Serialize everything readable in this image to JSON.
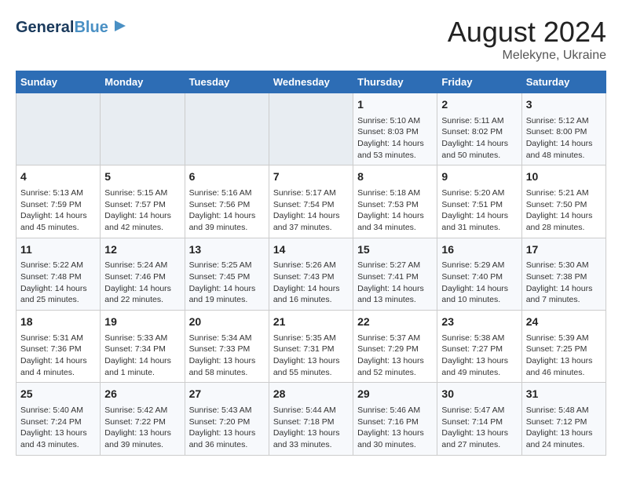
{
  "header": {
    "logo_line1": "General",
    "logo_line2": "Blue",
    "main_title": "August 2024",
    "sub_title": "Melekyne, Ukraine"
  },
  "days_of_week": [
    "Sunday",
    "Monday",
    "Tuesday",
    "Wednesday",
    "Thursday",
    "Friday",
    "Saturday"
  ],
  "weeks": [
    [
      {
        "day": "",
        "info": ""
      },
      {
        "day": "",
        "info": ""
      },
      {
        "day": "",
        "info": ""
      },
      {
        "day": "",
        "info": ""
      },
      {
        "day": "1",
        "info": "Sunrise: 5:10 AM\nSunset: 8:03 PM\nDaylight: 14 hours\nand 53 minutes."
      },
      {
        "day": "2",
        "info": "Sunrise: 5:11 AM\nSunset: 8:02 PM\nDaylight: 14 hours\nand 50 minutes."
      },
      {
        "day": "3",
        "info": "Sunrise: 5:12 AM\nSunset: 8:00 PM\nDaylight: 14 hours\nand 48 minutes."
      }
    ],
    [
      {
        "day": "4",
        "info": "Sunrise: 5:13 AM\nSunset: 7:59 PM\nDaylight: 14 hours\nand 45 minutes."
      },
      {
        "day": "5",
        "info": "Sunrise: 5:15 AM\nSunset: 7:57 PM\nDaylight: 14 hours\nand 42 minutes."
      },
      {
        "day": "6",
        "info": "Sunrise: 5:16 AM\nSunset: 7:56 PM\nDaylight: 14 hours\nand 39 minutes."
      },
      {
        "day": "7",
        "info": "Sunrise: 5:17 AM\nSunset: 7:54 PM\nDaylight: 14 hours\nand 37 minutes."
      },
      {
        "day": "8",
        "info": "Sunrise: 5:18 AM\nSunset: 7:53 PM\nDaylight: 14 hours\nand 34 minutes."
      },
      {
        "day": "9",
        "info": "Sunrise: 5:20 AM\nSunset: 7:51 PM\nDaylight: 14 hours\nand 31 minutes."
      },
      {
        "day": "10",
        "info": "Sunrise: 5:21 AM\nSunset: 7:50 PM\nDaylight: 14 hours\nand 28 minutes."
      }
    ],
    [
      {
        "day": "11",
        "info": "Sunrise: 5:22 AM\nSunset: 7:48 PM\nDaylight: 14 hours\nand 25 minutes."
      },
      {
        "day": "12",
        "info": "Sunrise: 5:24 AM\nSunset: 7:46 PM\nDaylight: 14 hours\nand 22 minutes."
      },
      {
        "day": "13",
        "info": "Sunrise: 5:25 AM\nSunset: 7:45 PM\nDaylight: 14 hours\nand 19 minutes."
      },
      {
        "day": "14",
        "info": "Sunrise: 5:26 AM\nSunset: 7:43 PM\nDaylight: 14 hours\nand 16 minutes."
      },
      {
        "day": "15",
        "info": "Sunrise: 5:27 AM\nSunset: 7:41 PM\nDaylight: 14 hours\nand 13 minutes."
      },
      {
        "day": "16",
        "info": "Sunrise: 5:29 AM\nSunset: 7:40 PM\nDaylight: 14 hours\nand 10 minutes."
      },
      {
        "day": "17",
        "info": "Sunrise: 5:30 AM\nSunset: 7:38 PM\nDaylight: 14 hours\nand 7 minutes."
      }
    ],
    [
      {
        "day": "18",
        "info": "Sunrise: 5:31 AM\nSunset: 7:36 PM\nDaylight: 14 hours\nand 4 minutes."
      },
      {
        "day": "19",
        "info": "Sunrise: 5:33 AM\nSunset: 7:34 PM\nDaylight: 14 hours\nand 1 minute."
      },
      {
        "day": "20",
        "info": "Sunrise: 5:34 AM\nSunset: 7:33 PM\nDaylight: 13 hours\nand 58 minutes."
      },
      {
        "day": "21",
        "info": "Sunrise: 5:35 AM\nSunset: 7:31 PM\nDaylight: 13 hours\nand 55 minutes."
      },
      {
        "day": "22",
        "info": "Sunrise: 5:37 AM\nSunset: 7:29 PM\nDaylight: 13 hours\nand 52 minutes."
      },
      {
        "day": "23",
        "info": "Sunrise: 5:38 AM\nSunset: 7:27 PM\nDaylight: 13 hours\nand 49 minutes."
      },
      {
        "day": "24",
        "info": "Sunrise: 5:39 AM\nSunset: 7:25 PM\nDaylight: 13 hours\nand 46 minutes."
      }
    ],
    [
      {
        "day": "25",
        "info": "Sunrise: 5:40 AM\nSunset: 7:24 PM\nDaylight: 13 hours\nand 43 minutes."
      },
      {
        "day": "26",
        "info": "Sunrise: 5:42 AM\nSunset: 7:22 PM\nDaylight: 13 hours\nand 39 minutes."
      },
      {
        "day": "27",
        "info": "Sunrise: 5:43 AM\nSunset: 7:20 PM\nDaylight: 13 hours\nand 36 minutes."
      },
      {
        "day": "28",
        "info": "Sunrise: 5:44 AM\nSunset: 7:18 PM\nDaylight: 13 hours\nand 33 minutes."
      },
      {
        "day": "29",
        "info": "Sunrise: 5:46 AM\nSunset: 7:16 PM\nDaylight: 13 hours\nand 30 minutes."
      },
      {
        "day": "30",
        "info": "Sunrise: 5:47 AM\nSunset: 7:14 PM\nDaylight: 13 hours\nand 27 minutes."
      },
      {
        "day": "31",
        "info": "Sunrise: 5:48 AM\nSunset: 7:12 PM\nDaylight: 13 hours\nand 24 minutes."
      }
    ]
  ]
}
